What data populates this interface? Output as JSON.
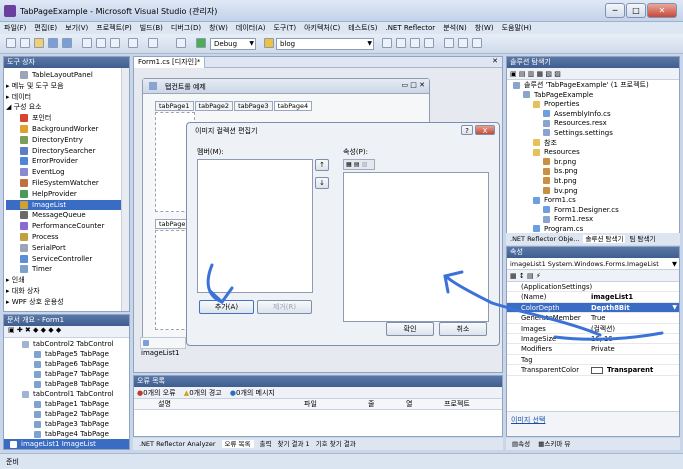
{
  "window": {
    "title": "TabPageExample - Microsoft Visual Studio (관리자)"
  },
  "window_buttons": {
    "minimize": "─",
    "maximize": "□",
    "close": "✕"
  },
  "menu": [
    "파일(F)",
    "편집(E)",
    "보기(V)",
    "프로젝트(P)",
    "빌드(B)",
    "디버그(D)",
    "창(W)",
    "데이터(A)",
    "도구(T)",
    "아키텍처(C)",
    "테스트(S)",
    ".NET Reflector",
    "분석(N)",
    "창(W)",
    "도움말(H)"
  ],
  "toolbar": {
    "config": "Debug",
    "search": "blog"
  },
  "toolbox": {
    "title": "도구 상자",
    "items": [
      {
        "t": "TableLayoutPanel",
        "k": "item"
      },
      {
        "t": "메뉴 및 도구 모음",
        "k": "group"
      },
      {
        "t": "데이터",
        "k": "group"
      },
      {
        "t": "구성 요소",
        "k": "group"
      },
      {
        "t": "포인터",
        "k": "item"
      },
      {
        "t": "BackgroundWorker",
        "k": "item"
      },
      {
        "t": "DirectoryEntry",
        "k": "item"
      },
      {
        "t": "DirectorySearcher",
        "k": "item"
      },
      {
        "t": "ErrorProvider",
        "k": "item"
      },
      {
        "t": "EventLog",
        "k": "item"
      },
      {
        "t": "FileSystemWatcher",
        "k": "item"
      },
      {
        "t": "HelpProvider",
        "k": "item"
      },
      {
        "t": "ImageList",
        "k": "sel"
      },
      {
        "t": "MessageQueue",
        "k": "item"
      },
      {
        "t": "PerformanceCounter",
        "k": "item"
      },
      {
        "t": "Process",
        "k": "item"
      },
      {
        "t": "SerialPort",
        "k": "item"
      },
      {
        "t": "ServiceController",
        "k": "item"
      },
      {
        "t": "Timer",
        "k": "item"
      },
      {
        "t": "인쇄",
        "k": "group"
      },
      {
        "t": "대화 상자",
        "k": "group"
      },
      {
        "t": "WPF 상호 운용성",
        "k": "group"
      }
    ]
  },
  "outline": {
    "title": "문서 개요 - Form1",
    "items": [
      {
        "t": "tabControl2  TabControl",
        "i": 1
      },
      {
        "t": "tabPage5  TabPage",
        "i": 2
      },
      {
        "t": "tabPage6  TabPage",
        "i": 2
      },
      {
        "t": "tabPage7  TabPage",
        "i": 2
      },
      {
        "t": "tabPage8  TabPage",
        "i": 2
      },
      {
        "t": "tabControl1  TabControl",
        "i": 1
      },
      {
        "t": "tabPage1  TabPage",
        "i": 2
      },
      {
        "t": "tabPage2  TabPage",
        "i": 2
      },
      {
        "t": "tabPage3  TabPage",
        "i": 2
      },
      {
        "t": "tabPage4  TabPage",
        "i": 2
      },
      {
        "t": "imageList1  ImageList",
        "i": 0,
        "sel": true
      }
    ]
  },
  "designer": {
    "doc_tab": "Form1.cs [디자인]*",
    "form_title": "탭컨트롤 예제",
    "tabs": [
      "tabPage1",
      "tabPage2",
      "tabPage3",
      "tabPage4"
    ],
    "tab2": "tabPage5",
    "tray": "imageList1"
  },
  "dialog": {
    "title": "이미지 컬렉션 편집기",
    "members": "멤버(M):",
    "props": "속성(P):",
    "add": "추가(A)",
    "remove": "제거(R)",
    "ok": "확인",
    "cancel": "취소",
    "up": "↑",
    "down": "↓",
    "help": "?",
    "close": "X"
  },
  "error_list": {
    "title": "오류 목록",
    "errors": "0개의 오류",
    "warnings": "0개의 경고",
    "messages": "0개의 메시지",
    "cols": [
      "설명",
      "파일",
      "줄",
      "열",
      "프로젝트"
    ]
  },
  "bottom_tabs": [
    ".NET Reflector Analyzer",
    "오류 목록",
    "출력",
    "찾기 결과 1",
    "기호 찾기 결과"
  ],
  "solution": {
    "title": "솔루션 탐색기",
    "items": [
      {
        "t": "솔루션 'TabPageExample' (1 프로젝트)",
        "i": 0
      },
      {
        "t": "TabPageExample",
        "i": 1
      },
      {
        "t": "Properties",
        "i": 2
      },
      {
        "t": "AssemblyInfo.cs",
        "i": 3
      },
      {
        "t": "Resources.resx",
        "i": 3
      },
      {
        "t": "Settings.settings",
        "i": 3
      },
      {
        "t": "참조",
        "i": 2
      },
      {
        "t": "Resources",
        "i": 2
      },
      {
        "t": "br.png",
        "i": 3
      },
      {
        "t": "bs.png",
        "i": 3
      },
      {
        "t": "bt.png",
        "i": 3
      },
      {
        "t": "bv.png",
        "i": 3
      },
      {
        "t": "Form1.cs",
        "i": 2
      },
      {
        "t": "Form1.Designer.cs",
        "i": 3
      },
      {
        "t": "Form1.resx",
        "i": 3
      },
      {
        "t": "Program.cs",
        "i": 2
      }
    ],
    "tabs": [
      ".NET Reflector Obje...",
      "솔루션 탐색기",
      "팀 탐색기"
    ]
  },
  "properties": {
    "title": "속성",
    "object": "imageList1 System.Windows.Forms.ImageList",
    "rows": [
      {
        "k": "(ApplicationSettings)",
        "v": "",
        "b": false
      },
      {
        "k": "(Name)",
        "v": "imageList1",
        "b": true
      },
      {
        "k": "ColorDepth",
        "v": "Depth8Bit",
        "b": true,
        "sel": true
      },
      {
        "k": "GenerateMember",
        "v": "True",
        "b": false
      },
      {
        "k": "Images",
        "v": "(컬렉션)",
        "b": false
      },
      {
        "k": "ImageSize",
        "v": "16, 16",
        "b": false
      },
      {
        "k": "Modifiers",
        "v": "Private",
        "b": false
      },
      {
        "k": "Tag",
        "v": "",
        "b": false
      },
      {
        "k": "TransparentColor",
        "v": "Transparent",
        "b": true
      }
    ],
    "link": "이미지 선택",
    "tabs": [
      "속성",
      "스키마 뷰"
    ]
  },
  "status": "준비"
}
